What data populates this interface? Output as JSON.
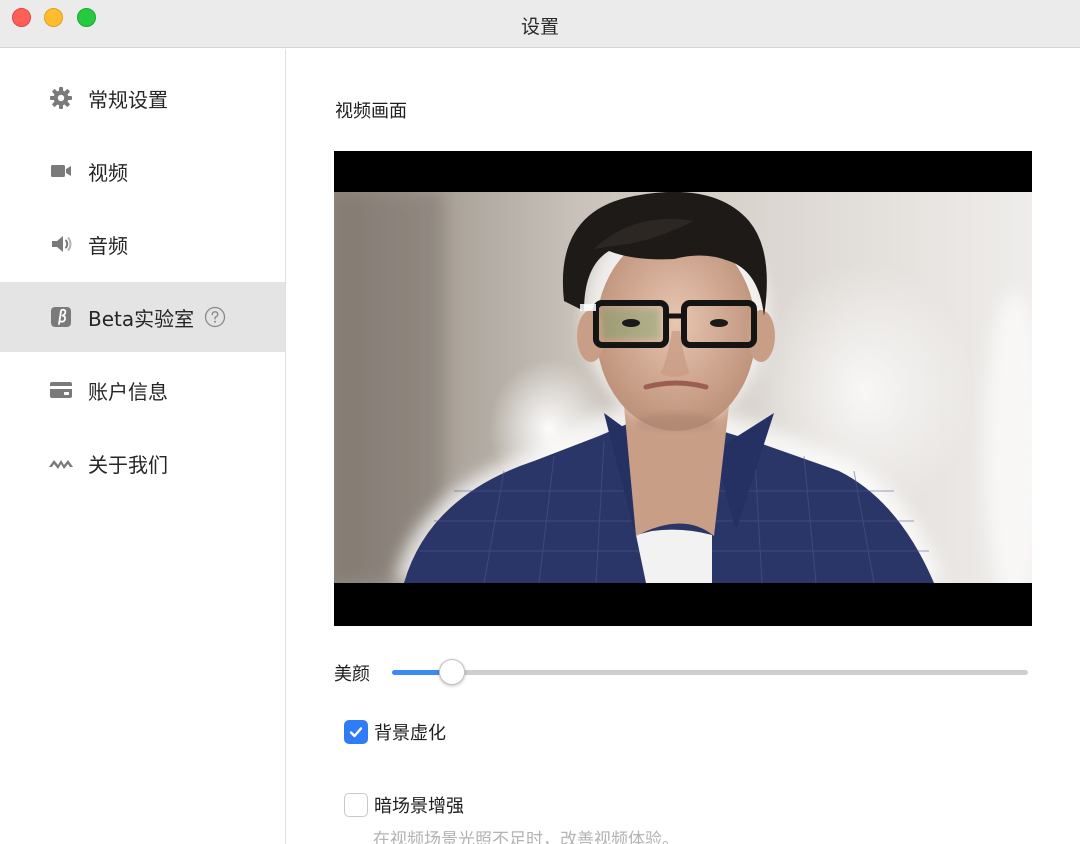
{
  "window": {
    "title": "设置"
  },
  "sidebar": {
    "items": [
      {
        "label": "常规设置",
        "icon": "gear-icon",
        "active": false
      },
      {
        "label": "视频",
        "icon": "video-camera-icon",
        "active": false
      },
      {
        "label": "音频",
        "icon": "speaker-icon",
        "active": false
      },
      {
        "label": "Beta实验室",
        "icon": "beta-icon",
        "active": true,
        "help_icon": "question-circle-icon"
      },
      {
        "label": "账户信息",
        "icon": "card-icon",
        "active": false
      },
      {
        "label": "关于我们",
        "icon": "logo-icon",
        "active": false
      }
    ]
  },
  "main": {
    "section_title": "视频画面",
    "beauty": {
      "label": "美颜",
      "value_fraction": 0.095
    },
    "background_blur": {
      "label": "背景虚化",
      "checked": true
    },
    "low_light": {
      "label": "暗场景增强",
      "checked": false,
      "description": "在视频场景光照不足时，改善视频体验。"
    }
  },
  "colors": {
    "accent": "#2f7cf6",
    "slider_fill": "#3a8cf5",
    "sidebar_active": "#e4e4e4"
  }
}
